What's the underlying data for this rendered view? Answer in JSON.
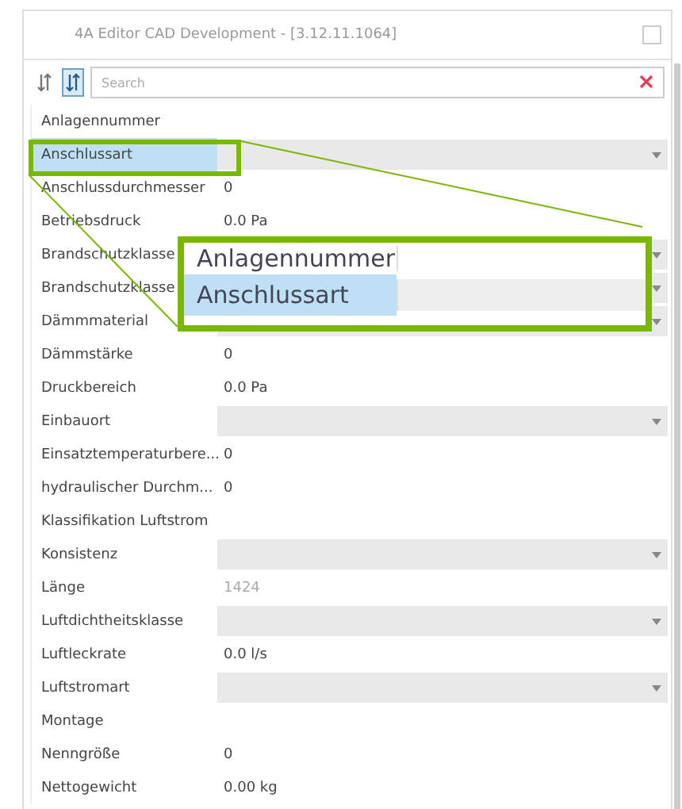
{
  "window": {
    "title": "4A Editor CAD Development - [3.12.11.1064]"
  },
  "toolbar": {
    "sort_modes": [
      {
        "selected": false
      },
      {
        "selected": true
      }
    ],
    "search": {
      "placeholder": "Search"
    }
  },
  "properties": [
    {
      "label": "Anlagennummer",
      "kind": "text",
      "selected": false
    },
    {
      "label": "Anschlussart",
      "kind": "dropdown",
      "selected": true
    },
    {
      "label": "Anschlussdurchmesser",
      "kind": "text",
      "value": "0",
      "selected": false
    },
    {
      "label": "Betriebsdruck",
      "kind": "text",
      "value": "0.0 Pa",
      "selected": false
    },
    {
      "label": "Brandschutzklasse",
      "kind": "dropdown",
      "selected": false
    },
    {
      "label": "Brandschutzklasse",
      "kind": "dropdown",
      "selected": false
    },
    {
      "label": "Dämmmaterial",
      "kind": "dropdown",
      "selected": false
    },
    {
      "label": "Dämmstärke",
      "kind": "text",
      "value": "0",
      "selected": false
    },
    {
      "label": "Druckbereich",
      "kind": "text",
      "value": "0.0 Pa",
      "selected": false
    },
    {
      "label": "Einbauort",
      "kind": "dropdown",
      "selected": false
    },
    {
      "label": "Einsatztemperaturbere...",
      "kind": "text",
      "value": "0",
      "selected": false
    },
    {
      "label": "hydraulischer Durchm...",
      "kind": "text",
      "value": "0",
      "selected": false
    },
    {
      "label": "Klassifikation Luftstrom",
      "kind": "text",
      "selected": false
    },
    {
      "label": "Konsistenz",
      "kind": "dropdown",
      "selected": false
    },
    {
      "label": "Länge",
      "kind": "readonly",
      "value": "1424",
      "selected": false
    },
    {
      "label": "Luftdichtheitsklasse",
      "kind": "dropdown",
      "selected": false
    },
    {
      "label": "Luftleckrate",
      "kind": "text",
      "value": "0.0 l/s",
      "selected": false
    },
    {
      "label": "Luftstromart",
      "kind": "dropdown",
      "selected": false
    },
    {
      "label": "Montage",
      "kind": "text",
      "selected": false
    },
    {
      "label": "Nenngröße",
      "kind": "text",
      "value": "0",
      "selected": false
    },
    {
      "label": "Nettogewicht",
      "kind": "text",
      "value": "0.00 kg",
      "selected": false
    }
  ],
  "magnifier": {
    "rows": [
      {
        "label": "Anlagennummer",
        "kind": "text",
        "selected": false
      },
      {
        "label": "Anschlussart",
        "kind": "dropdown",
        "selected": true
      }
    ]
  }
}
